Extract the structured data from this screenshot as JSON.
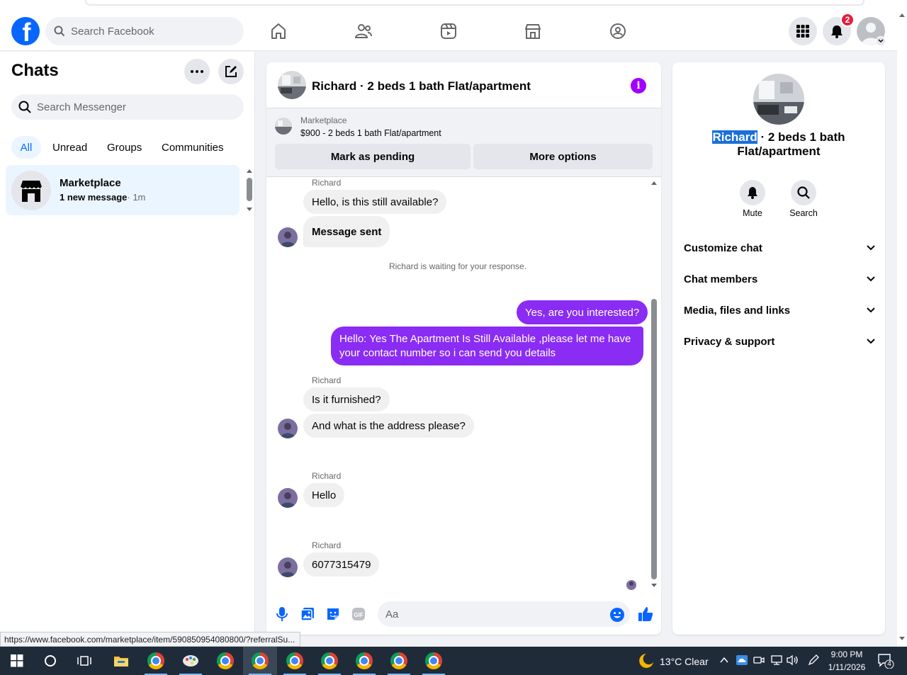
{
  "topnav": {
    "logo": "f",
    "search_placeholder": "Search Facebook",
    "notification_count": "2"
  },
  "sidebar": {
    "title": "Chats",
    "search_placeholder": "Search Messenger",
    "filters": [
      "All",
      "Unread",
      "Groups",
      "Communities"
    ],
    "conversation": {
      "name": "Marketplace",
      "preview": "1 new message",
      "time": "· 1m"
    }
  },
  "chat": {
    "title": "Richard · 2 beds 1 bath Flat/apartment",
    "info_icon": "i",
    "marketplace": {
      "label": "Marketplace",
      "listing": "$900 - 2 beds 1 bath Flat/apartment",
      "pending_button": "Mark as pending",
      "options_button": "More options"
    },
    "messages": {
      "m1_sender": "Richard",
      "m1": "Hello, is this still available?",
      "m2": "Message sent",
      "waiting": "Richard is waiting for your response.",
      "m3": "Yes, are you interested?",
      "m4_line1": "Hello: Yes The Apartment Is Still Available ,please let me have",
      "m4_line2": "your contact number so i can send you details",
      "m5_sender": "Richard",
      "m5": "Is it furnished?",
      "m6": "And what is the address please?",
      "m7_sender": "Richard",
      "m7": "Hello",
      "m8_sender": "Richard",
      "m8": "6077315479"
    },
    "composer_placeholder": "Aa"
  },
  "details": {
    "name_highlight": "Richard",
    "title_rest": " · 2 beds 1 bath",
    "title_line2": "Flat/apartment",
    "mute_label": "Mute",
    "search_label": "Search",
    "sections": [
      "Customize chat",
      "Chat members",
      "Media, files and links",
      "Privacy & support"
    ]
  },
  "status_url": "https://www.facebook.com/marketplace/item/590850954080800/?referralSu...",
  "taskbar": {
    "weather": "13°C  Clear",
    "time": "9:00 PM",
    "date": "1/11/2026",
    "notif_count": "4"
  },
  "colors": {
    "accent": "#0866ff",
    "outgoing_bubble": "#8a2cf3",
    "info_purple": "#a100ff"
  }
}
